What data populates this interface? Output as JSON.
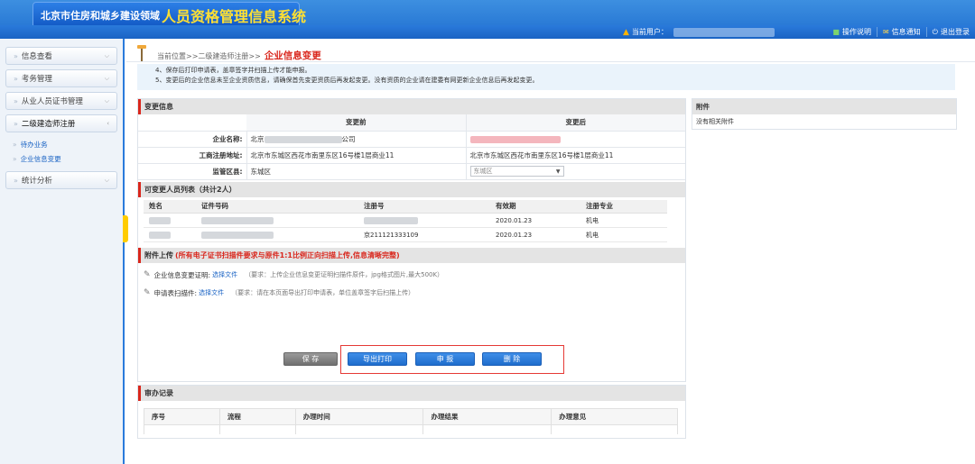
{
  "header": {
    "logo_small": "北京市住房和城乡建设领域",
    "logo_big": "人员资格管理信息系统",
    "current_user_label": "当前用户：",
    "links": {
      "help": "操作说明",
      "notify": "信息通知",
      "logout": "退出登录"
    }
  },
  "sidebar": {
    "items": [
      {
        "label": "信息查看"
      },
      {
        "label": "考务管理"
      },
      {
        "label": "从业人员证书管理"
      },
      {
        "label": "二级建造师注册"
      },
      {
        "label": "统计分析"
      }
    ],
    "subitems": [
      {
        "label": "待办业务"
      },
      {
        "label": "企业信息变更"
      }
    ]
  },
  "breadcrumb": {
    "path": "当前位置>>二级建造师注册>>",
    "current": "企业信息变更"
  },
  "notice": {
    "line1": "4、保存后打印申请表，盖章签字并扫描上传才能申报。",
    "line2": "5、变更后的企业信息未至企业资质信息，请确保首先变更资质后再发起变更。没有资质的企业请在建委有网更新企业信息后再发起变更。"
  },
  "change_info": {
    "title": "变更信息",
    "col_before": "变更前",
    "col_after": "变更后",
    "rows": {
      "company_label": "企业名称:",
      "company_before_prefix": "北京",
      "company_before_suffix": "公司",
      "address_label": "工商注册地址:",
      "address_before": "北京市东城区西花市南里东区16号楼1层商业11",
      "address_after": "北京市东城区西花市南里东区16号楼1层商业11",
      "district_label": "监管区县:",
      "district_before": "东城区",
      "district_after": "东城区"
    }
  },
  "attachments_side": {
    "title": "附件",
    "empty": "没有相关附件"
  },
  "persons": {
    "title": "可变更人员列表（共计2人）",
    "headers": [
      "姓名",
      "证件号码",
      "注册号",
      "有效期",
      "注册专业"
    ],
    "rows": [
      {
        "reg_no": "",
        "valid": "2020.01.23",
        "major": "机电"
      },
      {
        "reg_no": "京211121333109",
        "valid": "2020.01.23",
        "major": "机电"
      }
    ]
  },
  "upload": {
    "title": "附件上传",
    "warning": "(所有电子证书扫描件要求与原件1:1比例正向扫描上传,信息清晰完整)",
    "items": [
      {
        "label": "企业信息变更证明:",
        "link": "选择文件",
        "req": "（要求：上传企业信息变更证明扫描件原件，jpg格式图片,最大500K）"
      },
      {
        "label": "申请表扫描件:",
        "link": "选择文件",
        "req": "（要求：请在本页面导出打印申请表，单位盖章签字后扫描上传）"
      }
    ]
  },
  "buttons": {
    "save": "保 存",
    "export": "导出打印",
    "submit": "申 报",
    "delete": "删 除"
  },
  "records": {
    "title": "审办记录",
    "headers": [
      "序号",
      "流程",
      "办理时间",
      "办理结果",
      "办理意见"
    ]
  }
}
